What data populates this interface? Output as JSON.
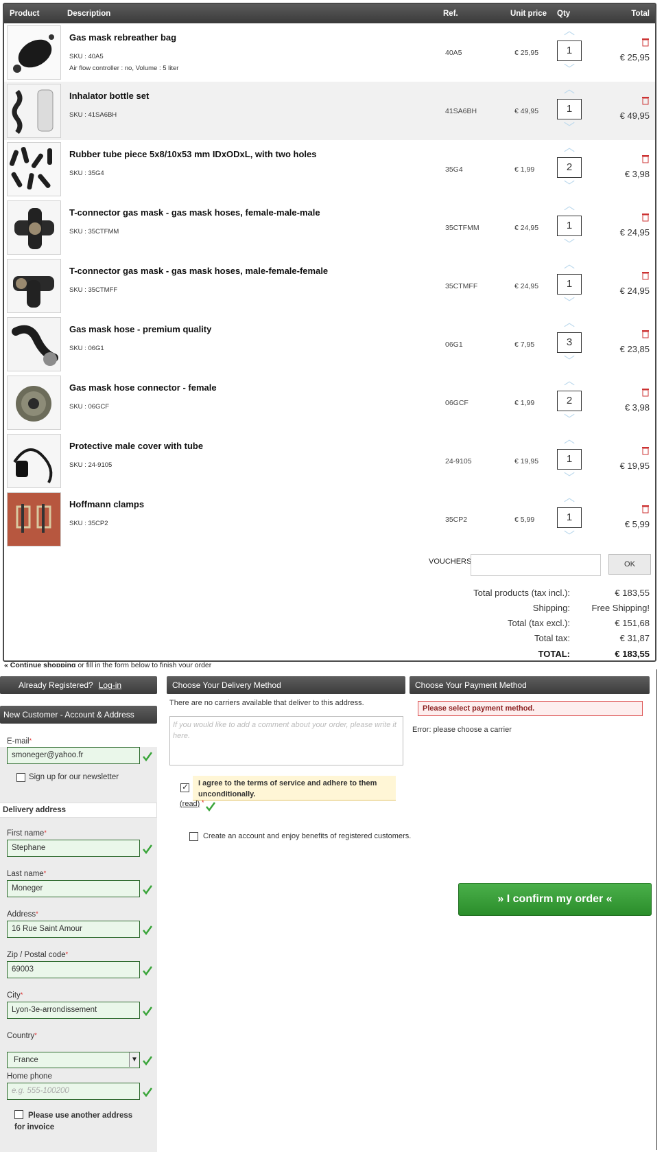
{
  "cart": {
    "columns": {
      "product": "Product",
      "description": "Description",
      "ref": "Ref.",
      "unit_price": "Unit price",
      "qty": "Qty",
      "total": "Total"
    },
    "items": [
      {
        "name": "Gas mask rebreather bag",
        "sku": "SKU : 40A5",
        "attr": "Air flow controller : no, Volume : 5 liter",
        "ref": "40A5",
        "price": "€ 25,95",
        "qty": "1",
        "total": "€ 25,95"
      },
      {
        "name": "Inhalator bottle set",
        "sku": "SKU : 41SA6BH",
        "attr": "",
        "ref": "41SA6BH",
        "price": "€ 49,95",
        "qty": "1",
        "total": "€ 49,95"
      },
      {
        "name": "Rubber tube piece 5x8/10x53 mm IDxODxL, with two holes",
        "sku": "SKU : 35G4",
        "attr": "",
        "ref": "35G4",
        "price": "€ 1,99",
        "qty": "2",
        "total": "€ 3,98"
      },
      {
        "name": "T-connector gas mask - gas mask hoses, female-male-male",
        "sku": "SKU : 35CTFMM",
        "attr": "",
        "ref": "35CTFMM",
        "price": "€ 24,95",
        "qty": "1",
        "total": "€ 24,95"
      },
      {
        "name": "T-connector gas mask - gas mask hoses, male-female-female",
        "sku": "SKU : 35CTMFF",
        "attr": "",
        "ref": "35CTMFF",
        "price": "€ 24,95",
        "qty": "1",
        "total": "€ 24,95"
      },
      {
        "name": "Gas mask hose - premium quality",
        "sku": "SKU : 06G1",
        "attr": "",
        "ref": "06G1",
        "price": "€ 7,95",
        "qty": "3",
        "total": "€ 23,85"
      },
      {
        "name": "Gas mask hose connector - female",
        "sku": "SKU : 06GCF",
        "attr": "",
        "ref": "06GCF",
        "price": "€ 1,99",
        "qty": "2",
        "total": "€ 3,98"
      },
      {
        "name": "Protective male cover with tube",
        "sku": "SKU : 24-9105",
        "attr": "",
        "ref": "24-9105",
        "price": "€ 19,95",
        "qty": "1",
        "total": "€ 19,95"
      },
      {
        "name": "Hoffmann clamps",
        "sku": "SKU : 35CP2",
        "attr": "",
        "ref": "35CP2",
        "price": "€ 5,99",
        "qty": "1",
        "total": "€ 5,99"
      }
    ],
    "voucher_label": "VOUCHERS",
    "voucher_ok": "OK",
    "summary": [
      {
        "label": "Total products (tax incl.):",
        "value": "€ 183,55"
      },
      {
        "label": "Shipping:",
        "value": "Free Shipping!"
      },
      {
        "label": "Total (tax excl.):",
        "value": "€ 151,68"
      },
      {
        "label": "Total tax:",
        "value": "€ 31,87"
      },
      {
        "label": "TOTAL:",
        "value": "€ 183,55"
      }
    ],
    "continue_link": "« Continue shopping",
    "continue_rest": " or fill in the form below to finish your order"
  },
  "account": {
    "registered_text": "Already Registered?",
    "login_link": "Log-in",
    "new_customer": "New Customer - Account & Address",
    "email_label": "E-mail",
    "email_value": "smoneger@yahoo.fr",
    "newsletter": "Sign up for our newsletter",
    "delivery_title": "Delivery address",
    "first_name_label": "First name",
    "first_name": "Stephane",
    "last_name_label": "Last name",
    "last_name": "Moneger",
    "address_label": "Address",
    "address": "16 Rue Saint Amour",
    "zip_label": "Zip / Postal code",
    "zip": "69003",
    "city_label": "City",
    "city": "Lyon-3e-arrondissement",
    "country_label": "Country",
    "country": "France",
    "phone_label": "Home phone",
    "phone_placeholder": "e.g. 555-100200",
    "invoice_address": "Please use another address for invoice"
  },
  "delivery": {
    "title": "Choose Your Delivery Method",
    "no_carriers": "There are no carriers available that deliver to this address.",
    "comment_placeholder": "If you would like to add a comment about your order, please write it here.",
    "terms": "I agree to the terms of service and adhere to them unconditionally.",
    "read_link": "(read)",
    "create_account": "Create an account and enjoy benefits of registered customers."
  },
  "payment": {
    "title": "Choose Your Payment Method",
    "error_box": "Please select payment method.",
    "error_text": "Error: please choose a carrier"
  },
  "confirm_button": "» I confirm my order «"
}
